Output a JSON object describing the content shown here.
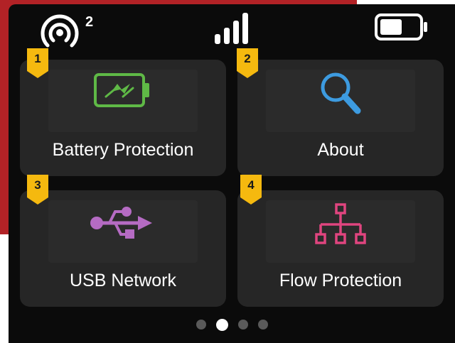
{
  "status_bar": {
    "hotspot_icon": "wireless-hotspot-icon",
    "connected_clients": "2",
    "signal_icon": "cellular-signal-icon",
    "battery_icon": "battery-level-icon"
  },
  "tiles": [
    {
      "number": "1",
      "label": "Battery Protection",
      "icon": "battery-charging-icon",
      "icon_color": "#5fb946"
    },
    {
      "number": "2",
      "label": "About",
      "icon": "magnifier-icon",
      "icon_color": "#3d9be0"
    },
    {
      "number": "3",
      "label": "USB Network",
      "icon": "usb-icon",
      "icon_color": "#b56bc3"
    },
    {
      "number": "4",
      "label": "Flow Protection",
      "icon": "network-tree-icon",
      "icon_color": "#e0457f"
    }
  ],
  "pagination": {
    "total": 4,
    "active_index": 1
  },
  "colors": {
    "badge": "#f5b90f",
    "tile_background": "#262626",
    "screen_background": "#0b0b0b",
    "frame": "#b22226"
  }
}
